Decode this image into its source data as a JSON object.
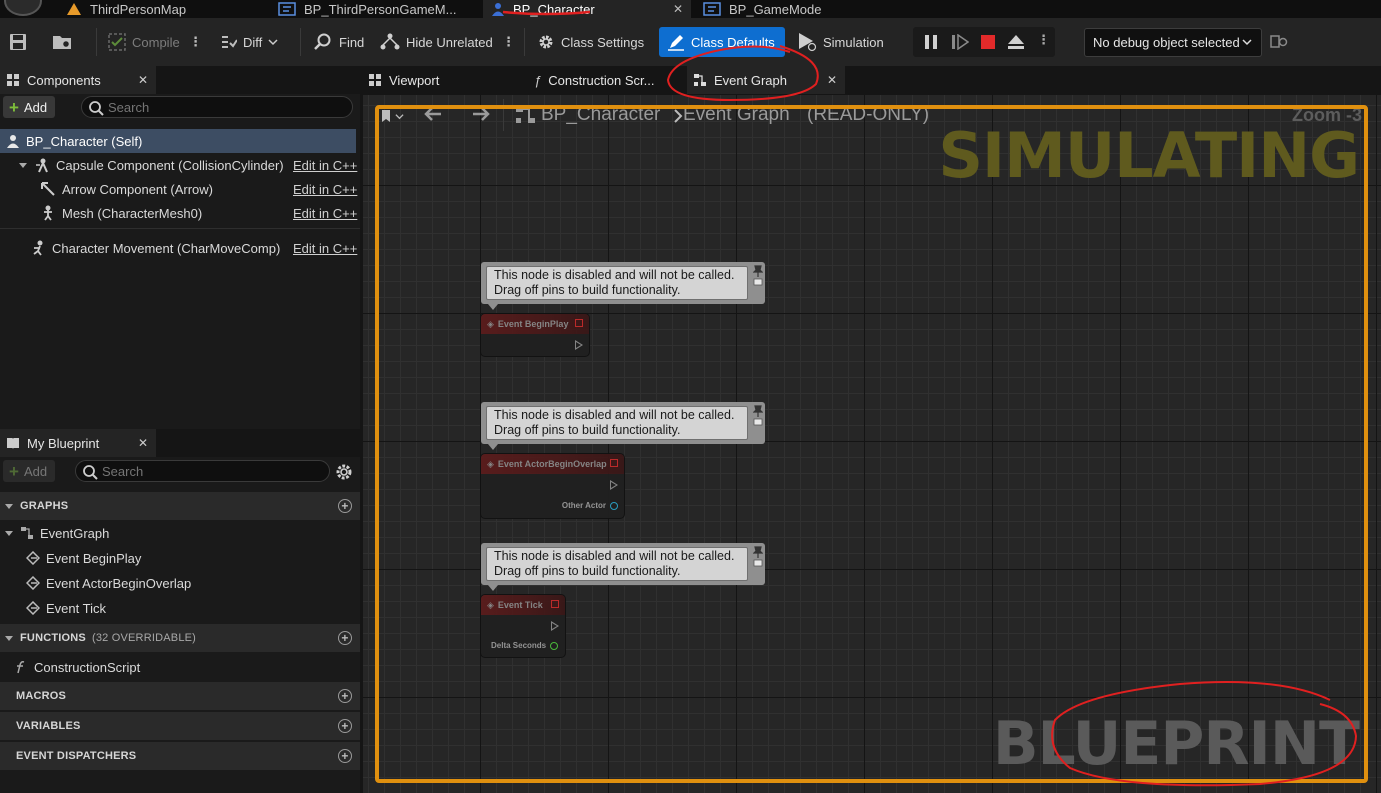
{
  "doc_tabs": [
    {
      "label": "ThirdPersonMap"
    },
    {
      "label": "BP_ThirdPersonGameM..."
    },
    {
      "label": "BP_Character"
    },
    {
      "label": "BP_GameMode"
    }
  ],
  "toolbar": {
    "compile": "Compile",
    "diff": "Diff",
    "find": "Find",
    "hide_unrelated": "Hide Unrelated",
    "class_settings": "Class Settings",
    "class_defaults": "Class Defaults",
    "simulation": "Simulation",
    "debug_object": "No debug object selected"
  },
  "components_panel": {
    "title": "Components",
    "add_label": "Add",
    "search_placeholder": "Search",
    "tree": [
      {
        "label": "BP_Character (Self)",
        "edit": ""
      },
      {
        "label": "Capsule Component (CollisionCylinder)",
        "edit": "Edit in C++"
      },
      {
        "label": "Arrow Component (Arrow)",
        "edit": "Edit in C++"
      },
      {
        "label": "Mesh (CharacterMesh0)",
        "edit": "Edit in C++"
      },
      {
        "label": "Character Movement (CharMoveComp)",
        "edit": "Edit in C++"
      }
    ]
  },
  "my_blueprint": {
    "title": "My Blueprint",
    "add_label": "Add",
    "search_placeholder": "Search",
    "graphs_header": "GRAPHS",
    "event_graph": "EventGraph",
    "events": [
      "Event BeginPlay",
      "Event ActorBeginOverlap",
      "Event Tick"
    ],
    "functions_header": "FUNCTIONS",
    "functions_sub": "(32 OVERRIDABLE)",
    "construction_script": "ConstructionScript",
    "macros_header": "MACROS",
    "variables_header": "VARIABLES",
    "dispatchers_header": "EVENT DISPATCHERS"
  },
  "editor_tabs": [
    {
      "label": "Viewport"
    },
    {
      "label": "Construction Scr..."
    },
    {
      "label": "Event Graph"
    }
  ],
  "graph": {
    "breadcrumb_bp": "BP_Character",
    "breadcrumb_graph": "Event Graph",
    "read_only": "(READ-ONLY)",
    "zoom": "Zoom -3",
    "simulating": "SIMULATING",
    "watermark": "BLUEPRINT",
    "comment_line1": "This node is disabled and will not be called.",
    "comment_line2": "Drag off pins to build functionality.",
    "nodes": [
      {
        "title": "Event BeginPlay",
        "param": ""
      },
      {
        "title": "Event ActorBeginOverlap",
        "param": "Other Actor"
      },
      {
        "title": "Event Tick",
        "param": "Delta Seconds"
      }
    ]
  },
  "colors": {
    "accent_blue": "#0e6ed0",
    "simulating_border": "#e0900f",
    "selected_row": "#3d4d63",
    "annotation_red": "#e02020"
  }
}
